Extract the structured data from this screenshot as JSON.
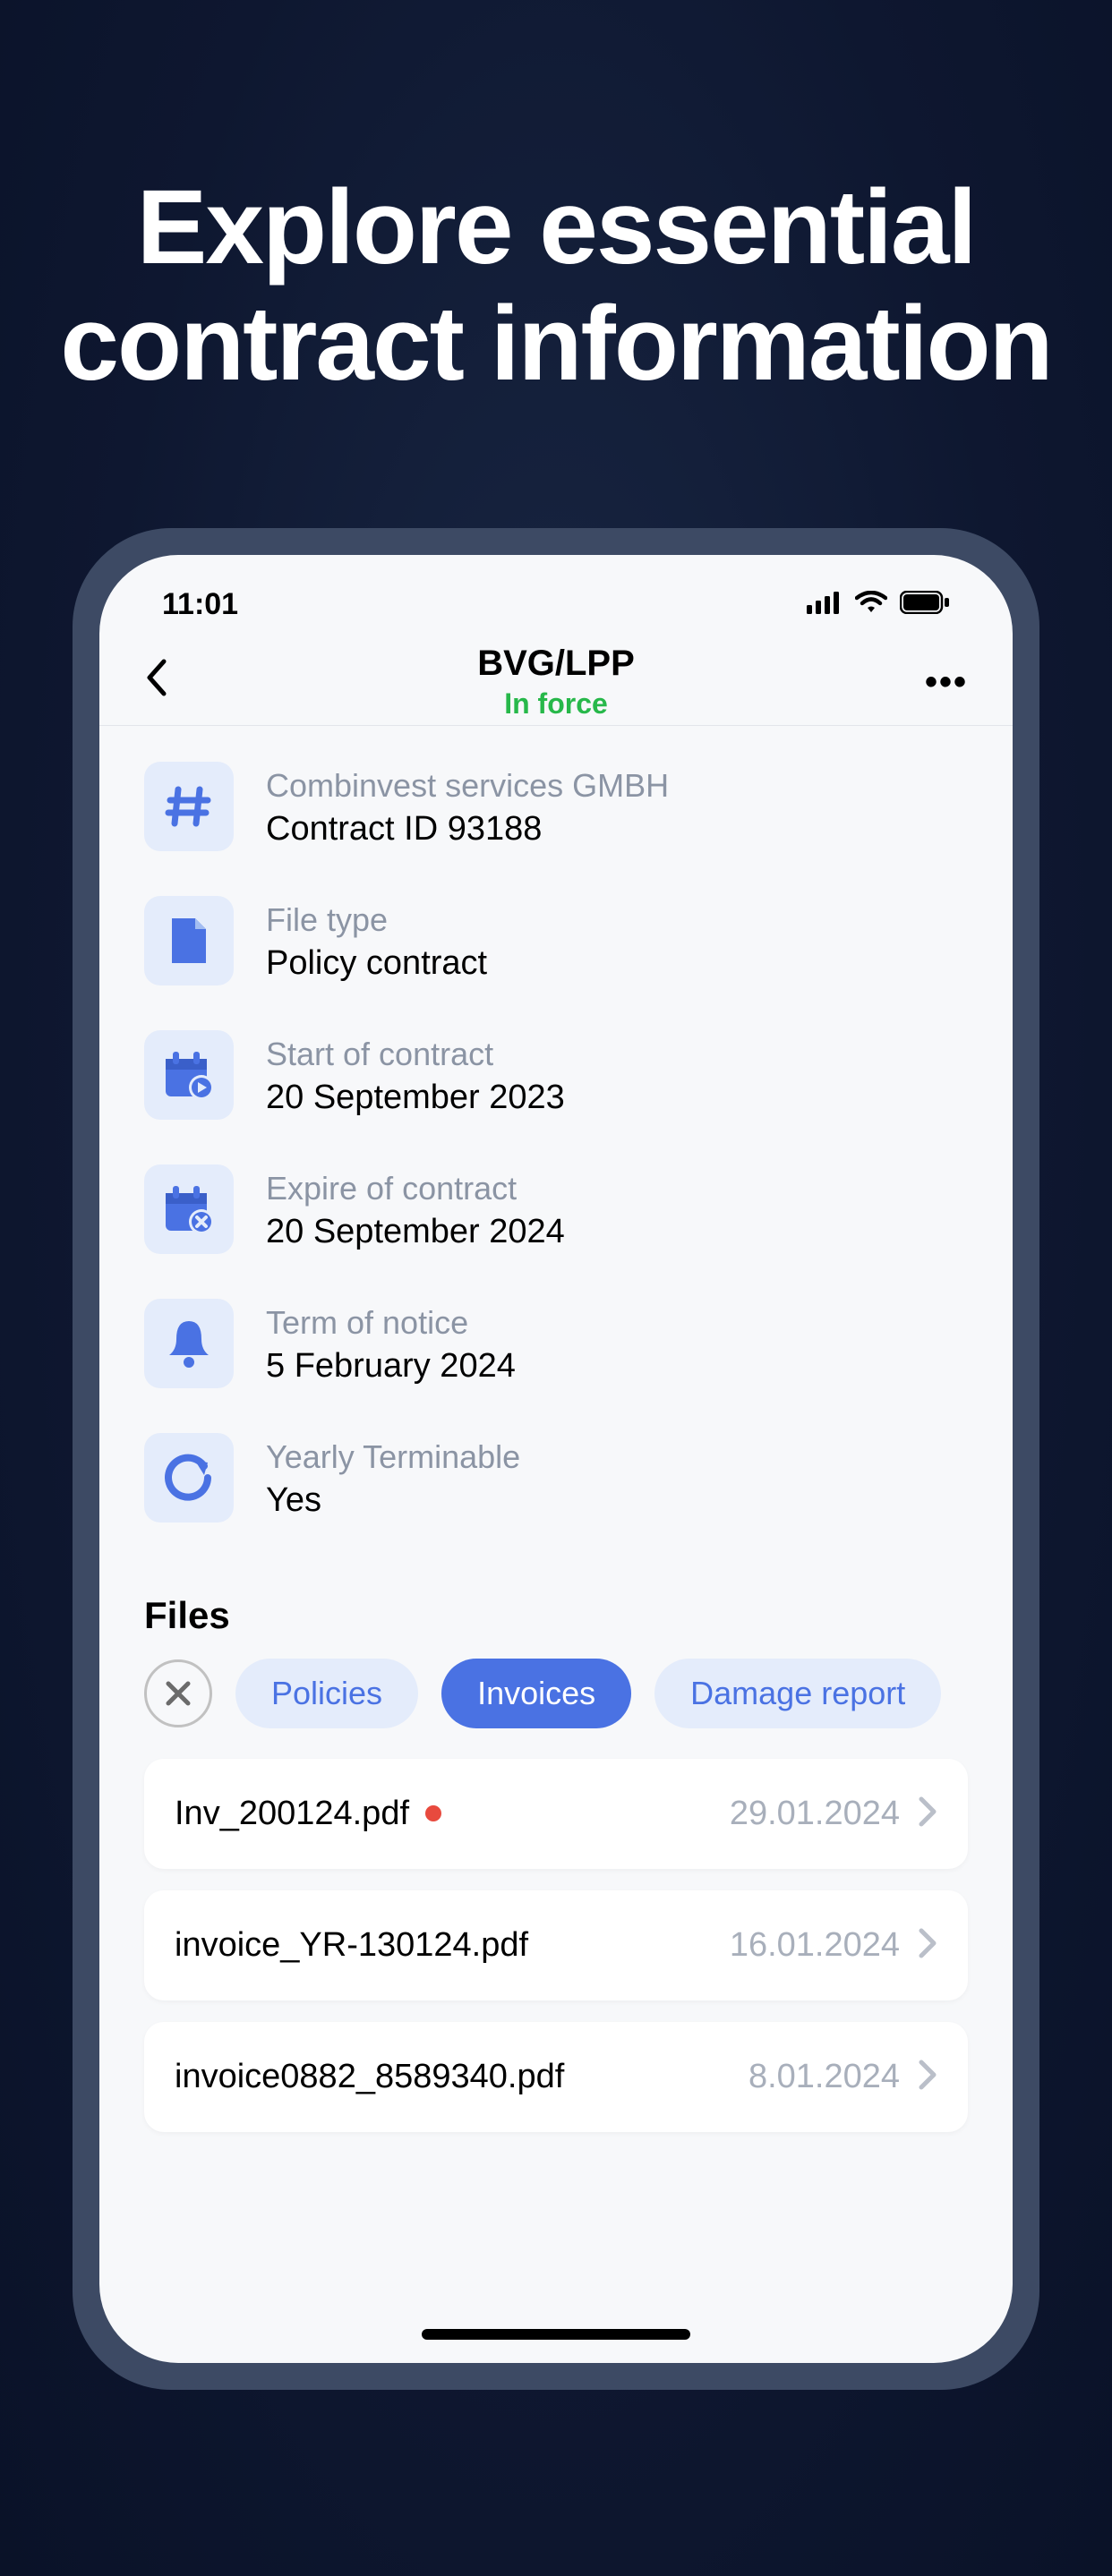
{
  "marketing": {
    "headline_line1": "Explore essential",
    "headline_line2": "contract information"
  },
  "status": {
    "time": "11:01"
  },
  "nav": {
    "title": "BVG/LPP",
    "subtitle": "In force",
    "more": "•••"
  },
  "details": [
    {
      "icon": "hash",
      "label": "Combinvest services GMBH",
      "value": "Contract ID 93188"
    },
    {
      "icon": "file",
      "label": "File type",
      "value": "Policy contract"
    },
    {
      "icon": "calstart",
      "label": "Start of contract",
      "value": "20 September 2023"
    },
    {
      "icon": "calend",
      "label": "Expire of contract",
      "value": "20 September 2024"
    },
    {
      "icon": "bell",
      "label": "Term of notice",
      "value": "5 February 2024"
    },
    {
      "icon": "refresh",
      "label": "Yearly Terminable",
      "value": "Yes"
    }
  ],
  "files": {
    "section_title": "Files",
    "filters": [
      {
        "label": "Policies",
        "active": false
      },
      {
        "label": "Invoices",
        "active": true
      },
      {
        "label": "Damage report",
        "active": false
      }
    ],
    "items": [
      {
        "name": "Inv_200124.pdf",
        "date": "29.01.2024",
        "is_new": true
      },
      {
        "name": "invoice_YR-130124.pdf",
        "date": "16.01.2024",
        "is_new": false
      },
      {
        "name": "invoice0882_8589340.pdf",
        "date": "8.01.2024",
        "is_new": false
      }
    ]
  }
}
